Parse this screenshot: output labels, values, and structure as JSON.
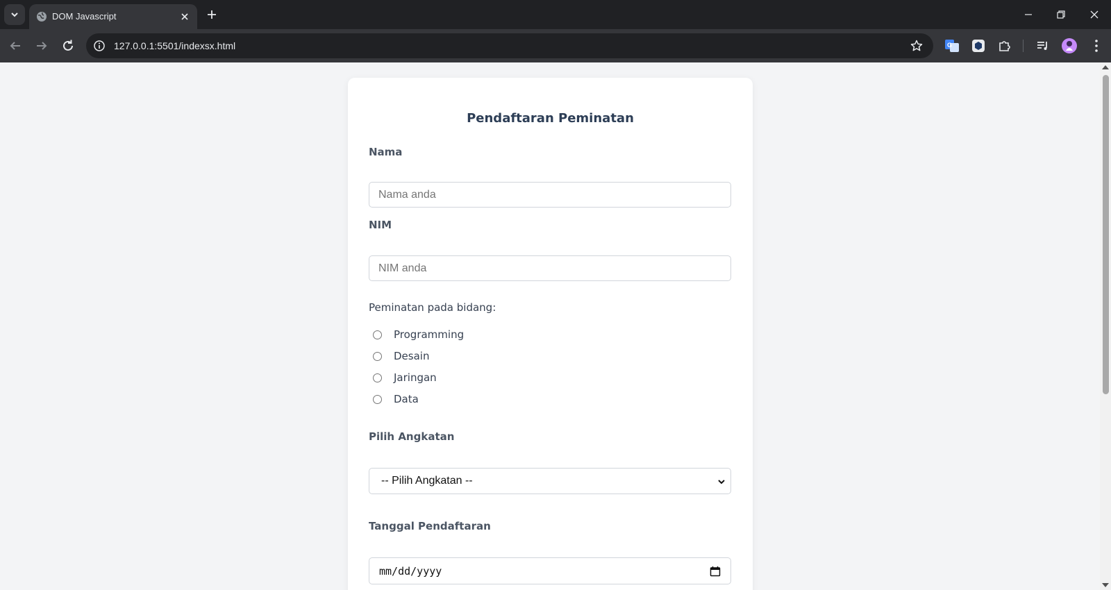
{
  "browser": {
    "tab_title": "DOM Javascript",
    "url": "127.0.0.1:5501/indexsx.html",
    "accent_avatar_color": "#c58af9"
  },
  "form": {
    "title": "Pendaftaran Peminatan",
    "nama_label": "Nama",
    "nama_placeholder": "Nama anda",
    "nim_label": "NIM",
    "nim_placeholder": "NIM anda",
    "peminatan_label": "Peminatan pada bidang:",
    "peminatan_options": [
      "Programming",
      "Desain",
      "Jaringan",
      "Data"
    ],
    "angkatan_label": "Pilih Angkatan",
    "angkatan_selected": "-- Pilih Angkatan --",
    "tanggal_label": "Tanggal Pendaftaran",
    "tanggal_placeholder": "mm/dd/yyyy"
  }
}
